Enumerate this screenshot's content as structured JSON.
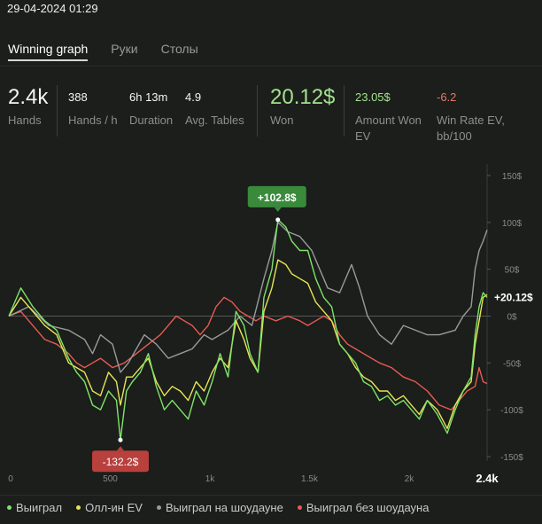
{
  "header": {
    "datetime": "29-04-2024 01:29"
  },
  "tabs": [
    {
      "label": "Winning graph",
      "active": true
    },
    {
      "label": "Руки",
      "active": false
    },
    {
      "label": "Столы",
      "active": false
    }
  ],
  "stats": {
    "hands": {
      "value": "2.4k",
      "label": "Hands"
    },
    "hands_per_hour": {
      "value": "388",
      "label": "Hands / h"
    },
    "duration": {
      "value": "6h 13m",
      "label": "Duration"
    },
    "avg_tables": {
      "value": "4.9",
      "label": "Avg. Tables"
    },
    "won": {
      "value": "20.12$",
      "label": "Won"
    },
    "amount_won_ev": {
      "value": "23.05$",
      "label_line1": "Amount Won",
      "label_line2": "EV"
    },
    "win_rate_ev": {
      "value": "-6.2",
      "label_line1": "Win Rate EV,",
      "label_line2": "bb/100"
    }
  },
  "colors": {
    "green": "#7fe36b",
    "yellow": "#e8e455",
    "gray": "#9a9a9a",
    "red": "#e85a55",
    "positive": "#a3e08f",
    "negative": "#e07a6e",
    "max_badge": "#3a8a3c",
    "min_badge": "#b8403d"
  },
  "chart_data": {
    "type": "line",
    "xlim": [
      0,
      2400
    ],
    "ylim": [
      -150,
      150
    ],
    "x_ticks": [
      {
        "value": 0,
        "label": "0"
      },
      {
        "value": 500,
        "label": "500"
      },
      {
        "value": 1000,
        "label": "1k"
      },
      {
        "value": 1500,
        "label": "1.5k"
      },
      {
        "value": 2000,
        "label": "2k"
      },
      {
        "value": 2400,
        "label": "2.4k"
      }
    ],
    "y_ticks": [
      {
        "value": 150,
        "label": "150$"
      },
      {
        "value": 100,
        "label": "100$"
      },
      {
        "value": 50,
        "label": "50$"
      },
      {
        "value": 0,
        "label": "0$"
      },
      {
        "value": -50,
        "label": "-50$"
      },
      {
        "value": -100,
        "label": "-100$"
      },
      {
        "value": -150,
        "label": "-150$"
      }
    ],
    "max_label": "+102.8$",
    "max_point": {
      "x": 1350,
      "y": 102.8
    },
    "min_label": "-132.2$",
    "min_point": {
      "x": 560,
      "y": -132.2
    },
    "current_label": "+20.12$",
    "series": [
      {
        "name": "Выиграл",
        "color": "#7fe36b",
        "points": [
          [
            0,
            0
          ],
          [
            60,
            30
          ],
          [
            120,
            10
          ],
          [
            180,
            -5
          ],
          [
            240,
            -15
          ],
          [
            300,
            -45
          ],
          [
            340,
            -60
          ],
          [
            380,
            -70
          ],
          [
            420,
            -95
          ],
          [
            460,
            -100
          ],
          [
            500,
            -80
          ],
          [
            540,
            -90
          ],
          [
            560,
            -132
          ],
          [
            590,
            -80
          ],
          [
            620,
            -70
          ],
          [
            660,
            -60
          ],
          [
            700,
            -40
          ],
          [
            740,
            -75
          ],
          [
            780,
            -100
          ],
          [
            820,
            -90
          ],
          [
            860,
            -100
          ],
          [
            900,
            -110
          ],
          [
            940,
            -80
          ],
          [
            980,
            -95
          ],
          [
            1020,
            -70
          ],
          [
            1060,
            -40
          ],
          [
            1100,
            -65
          ],
          [
            1140,
            5
          ],
          [
            1180,
            -10
          ],
          [
            1210,
            -40
          ],
          [
            1250,
            -60
          ],
          [
            1280,
            20
          ],
          [
            1320,
            50
          ],
          [
            1350,
            103
          ],
          [
            1390,
            95
          ],
          [
            1420,
            80
          ],
          [
            1460,
            70
          ],
          [
            1500,
            70
          ],
          [
            1540,
            40
          ],
          [
            1580,
            20
          ],
          [
            1620,
            10
          ],
          [
            1660,
            -30
          ],
          [
            1700,
            -40
          ],
          [
            1740,
            -50
          ],
          [
            1780,
            -70
          ],
          [
            1820,
            -75
          ],
          [
            1860,
            -90
          ],
          [
            1900,
            -85
          ],
          [
            1940,
            -95
          ],
          [
            1980,
            -90
          ],
          [
            2020,
            -100
          ],
          [
            2060,
            -110
          ],
          [
            2100,
            -90
          ],
          [
            2150,
            -105
          ],
          [
            2200,
            -125
          ],
          [
            2240,
            -100
          ],
          [
            2280,
            -80
          ],
          [
            2320,
            -65
          ],
          [
            2340,
            -20
          ],
          [
            2360,
            10
          ],
          [
            2380,
            25
          ],
          [
            2400,
            20
          ]
        ]
      },
      {
        "name": "Олл-ин EV",
        "color": "#e8e455",
        "points": [
          [
            0,
            0
          ],
          [
            60,
            20
          ],
          [
            120,
            5
          ],
          [
            180,
            -10
          ],
          [
            240,
            -20
          ],
          [
            300,
            -50
          ],
          [
            340,
            -55
          ],
          [
            380,
            -60
          ],
          [
            420,
            -80
          ],
          [
            460,
            -85
          ],
          [
            500,
            -60
          ],
          [
            540,
            -70
          ],
          [
            560,
            -95
          ],
          [
            590,
            -65
          ],
          [
            620,
            -65
          ],
          [
            660,
            -55
          ],
          [
            700,
            -45
          ],
          [
            740,
            -70
          ],
          [
            780,
            -85
          ],
          [
            820,
            -75
          ],
          [
            860,
            -80
          ],
          [
            900,
            -90
          ],
          [
            940,
            -70
          ],
          [
            980,
            -80
          ],
          [
            1020,
            -60
          ],
          [
            1060,
            -45
          ],
          [
            1100,
            -55
          ],
          [
            1140,
            -5
          ],
          [
            1180,
            -25
          ],
          [
            1210,
            -45
          ],
          [
            1250,
            -60
          ],
          [
            1280,
            5
          ],
          [
            1320,
            30
          ],
          [
            1350,
            60
          ],
          [
            1390,
            55
          ],
          [
            1420,
            45
          ],
          [
            1460,
            40
          ],
          [
            1500,
            35
          ],
          [
            1540,
            15
          ],
          [
            1580,
            5
          ],
          [
            1620,
            -5
          ],
          [
            1660,
            -30
          ],
          [
            1700,
            -40
          ],
          [
            1740,
            -55
          ],
          [
            1780,
            -65
          ],
          [
            1820,
            -70
          ],
          [
            1860,
            -80
          ],
          [
            1900,
            -80
          ],
          [
            1940,
            -90
          ],
          [
            1980,
            -85
          ],
          [
            2020,
            -95
          ],
          [
            2060,
            -105
          ],
          [
            2100,
            -90
          ],
          [
            2150,
            -100
          ],
          [
            2200,
            -120
          ],
          [
            2240,
            -95
          ],
          [
            2280,
            -80
          ],
          [
            2320,
            -70
          ],
          [
            2340,
            -30
          ],
          [
            2360,
            -5
          ],
          [
            2380,
            20
          ],
          [
            2400,
            23
          ]
        ]
      },
      {
        "name": "Выиграл на шоудауне",
        "color": "#9a9a9a",
        "points": [
          [
            0,
            0
          ],
          [
            100,
            10
          ],
          [
            200,
            -10
          ],
          [
            300,
            -15
          ],
          [
            380,
            -25
          ],
          [
            420,
            -40
          ],
          [
            460,
            -20
          ],
          [
            520,
            -30
          ],
          [
            560,
            -60
          ],
          [
            600,
            -50
          ],
          [
            680,
            -20
          ],
          [
            740,
            -30
          ],
          [
            800,
            -45
          ],
          [
            860,
            -40
          ],
          [
            920,
            -35
          ],
          [
            980,
            -20
          ],
          [
            1020,
            -25
          ],
          [
            1100,
            -15
          ],
          [
            1160,
            0
          ],
          [
            1220,
            -10
          ],
          [
            1280,
            40
          ],
          [
            1320,
            70
          ],
          [
            1350,
            100
          ],
          [
            1400,
            90
          ],
          [
            1460,
            85
          ],
          [
            1520,
            70
          ],
          [
            1560,
            50
          ],
          [
            1600,
            30
          ],
          [
            1660,
            25
          ],
          [
            1720,
            55
          ],
          [
            1760,
            30
          ],
          [
            1800,
            0
          ],
          [
            1860,
            -20
          ],
          [
            1920,
            -30
          ],
          [
            1980,
            -10
          ],
          [
            2040,
            -15
          ],
          [
            2100,
            -20
          ],
          [
            2160,
            -20
          ],
          [
            2240,
            -15
          ],
          [
            2280,
            0
          ],
          [
            2320,
            10
          ],
          [
            2340,
            50
          ],
          [
            2360,
            70
          ],
          [
            2380,
            80
          ],
          [
            2400,
            92
          ]
        ]
      },
      {
        "name": "Выиграл без шоудауна",
        "color": "#e85a55",
        "points": [
          [
            0,
            0
          ],
          [
            60,
            5
          ],
          [
            120,
            -10
          ],
          [
            180,
            -25
          ],
          [
            240,
            -30
          ],
          [
            300,
            -40
          ],
          [
            340,
            -50
          ],
          [
            380,
            -55
          ],
          [
            420,
            -50
          ],
          [
            460,
            -45
          ],
          [
            520,
            -55
          ],
          [
            580,
            -50
          ],
          [
            640,
            -40
          ],
          [
            700,
            -30
          ],
          [
            760,
            -20
          ],
          [
            800,
            -10
          ],
          [
            840,
            0
          ],
          [
            880,
            -5
          ],
          [
            920,
            -10
          ],
          [
            960,
            -20
          ],
          [
            1000,
            -10
          ],
          [
            1040,
            10
          ],
          [
            1080,
            20
          ],
          [
            1120,
            15
          ],
          [
            1160,
            5
          ],
          [
            1200,
            0
          ],
          [
            1240,
            -5
          ],
          [
            1280,
            0
          ],
          [
            1340,
            -5
          ],
          [
            1400,
            0
          ],
          [
            1460,
            -5
          ],
          [
            1500,
            -10
          ],
          [
            1540,
            -5
          ],
          [
            1580,
            0
          ],
          [
            1620,
            -5
          ],
          [
            1660,
            -20
          ],
          [
            1700,
            -30
          ],
          [
            1740,
            -35
          ],
          [
            1780,
            -40
          ],
          [
            1820,
            -45
          ],
          [
            1860,
            -50
          ],
          [
            1920,
            -55
          ],
          [
            1980,
            -65
          ],
          [
            2040,
            -70
          ],
          [
            2100,
            -80
          ],
          [
            2160,
            -95
          ],
          [
            2220,
            -100
          ],
          [
            2260,
            -90
          ],
          [
            2300,
            -80
          ],
          [
            2340,
            -75
          ],
          [
            2360,
            -55
          ],
          [
            2380,
            -70
          ],
          [
            2400,
            -72
          ]
        ]
      }
    ]
  }
}
